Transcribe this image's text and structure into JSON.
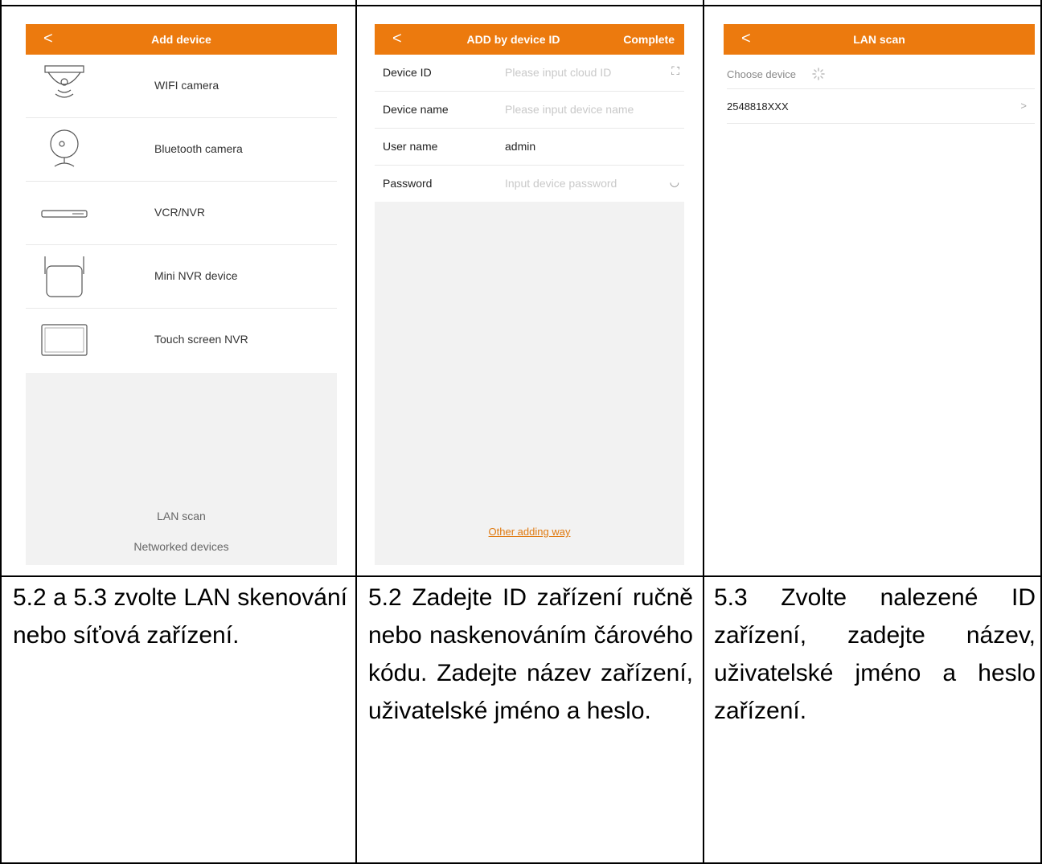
{
  "screens": {
    "add_device": {
      "back": "<",
      "title": "Add device",
      "devices": [
        "WIFI camera",
        "Bluetooth camera",
        "VCR/NVR",
        "Mini NVR device",
        "Touch screen NVR"
      ],
      "lan_scan": "LAN scan",
      "networked_devices": "Networked devices"
    },
    "add_by_id": {
      "back": "<",
      "title": "ADD by device ID",
      "complete": "Complete",
      "fields": [
        {
          "label": "Device ID",
          "value": "Please input cloud ID",
          "icon": "scan-icon",
          "icon_glyph": "⛶"
        },
        {
          "label": "Device name",
          "value": "Please input device name"
        },
        {
          "label": "User name",
          "value": "admin"
        },
        {
          "label": "Password",
          "value": "Input device password",
          "icon": "eye-closed-icon",
          "icon_glyph": "◡"
        }
      ],
      "other_way": "Other adding way"
    },
    "lan_scan": {
      "back": "<",
      "title": "LAN scan",
      "choose_device": "Choose device",
      "device_id": "2548818XXX",
      "chevron": ">"
    }
  },
  "captions": {
    "col1": "5.2 a 5.3 zvolte LAN skenování nebo síťová zařízení.",
    "col2": "5.2 Zadejte ID zařízení ručně nebo naskenováním čárového kódu. Zadejte název zařízení, uživatelské jméno a heslo.",
    "col3": "5.3 Zvolte nalezené ID zařízení, zadejte název, uživatelské jméno a heslo zařízení."
  },
  "colors": {
    "accent": "#ec7a0e",
    "link": "#e07a10"
  }
}
